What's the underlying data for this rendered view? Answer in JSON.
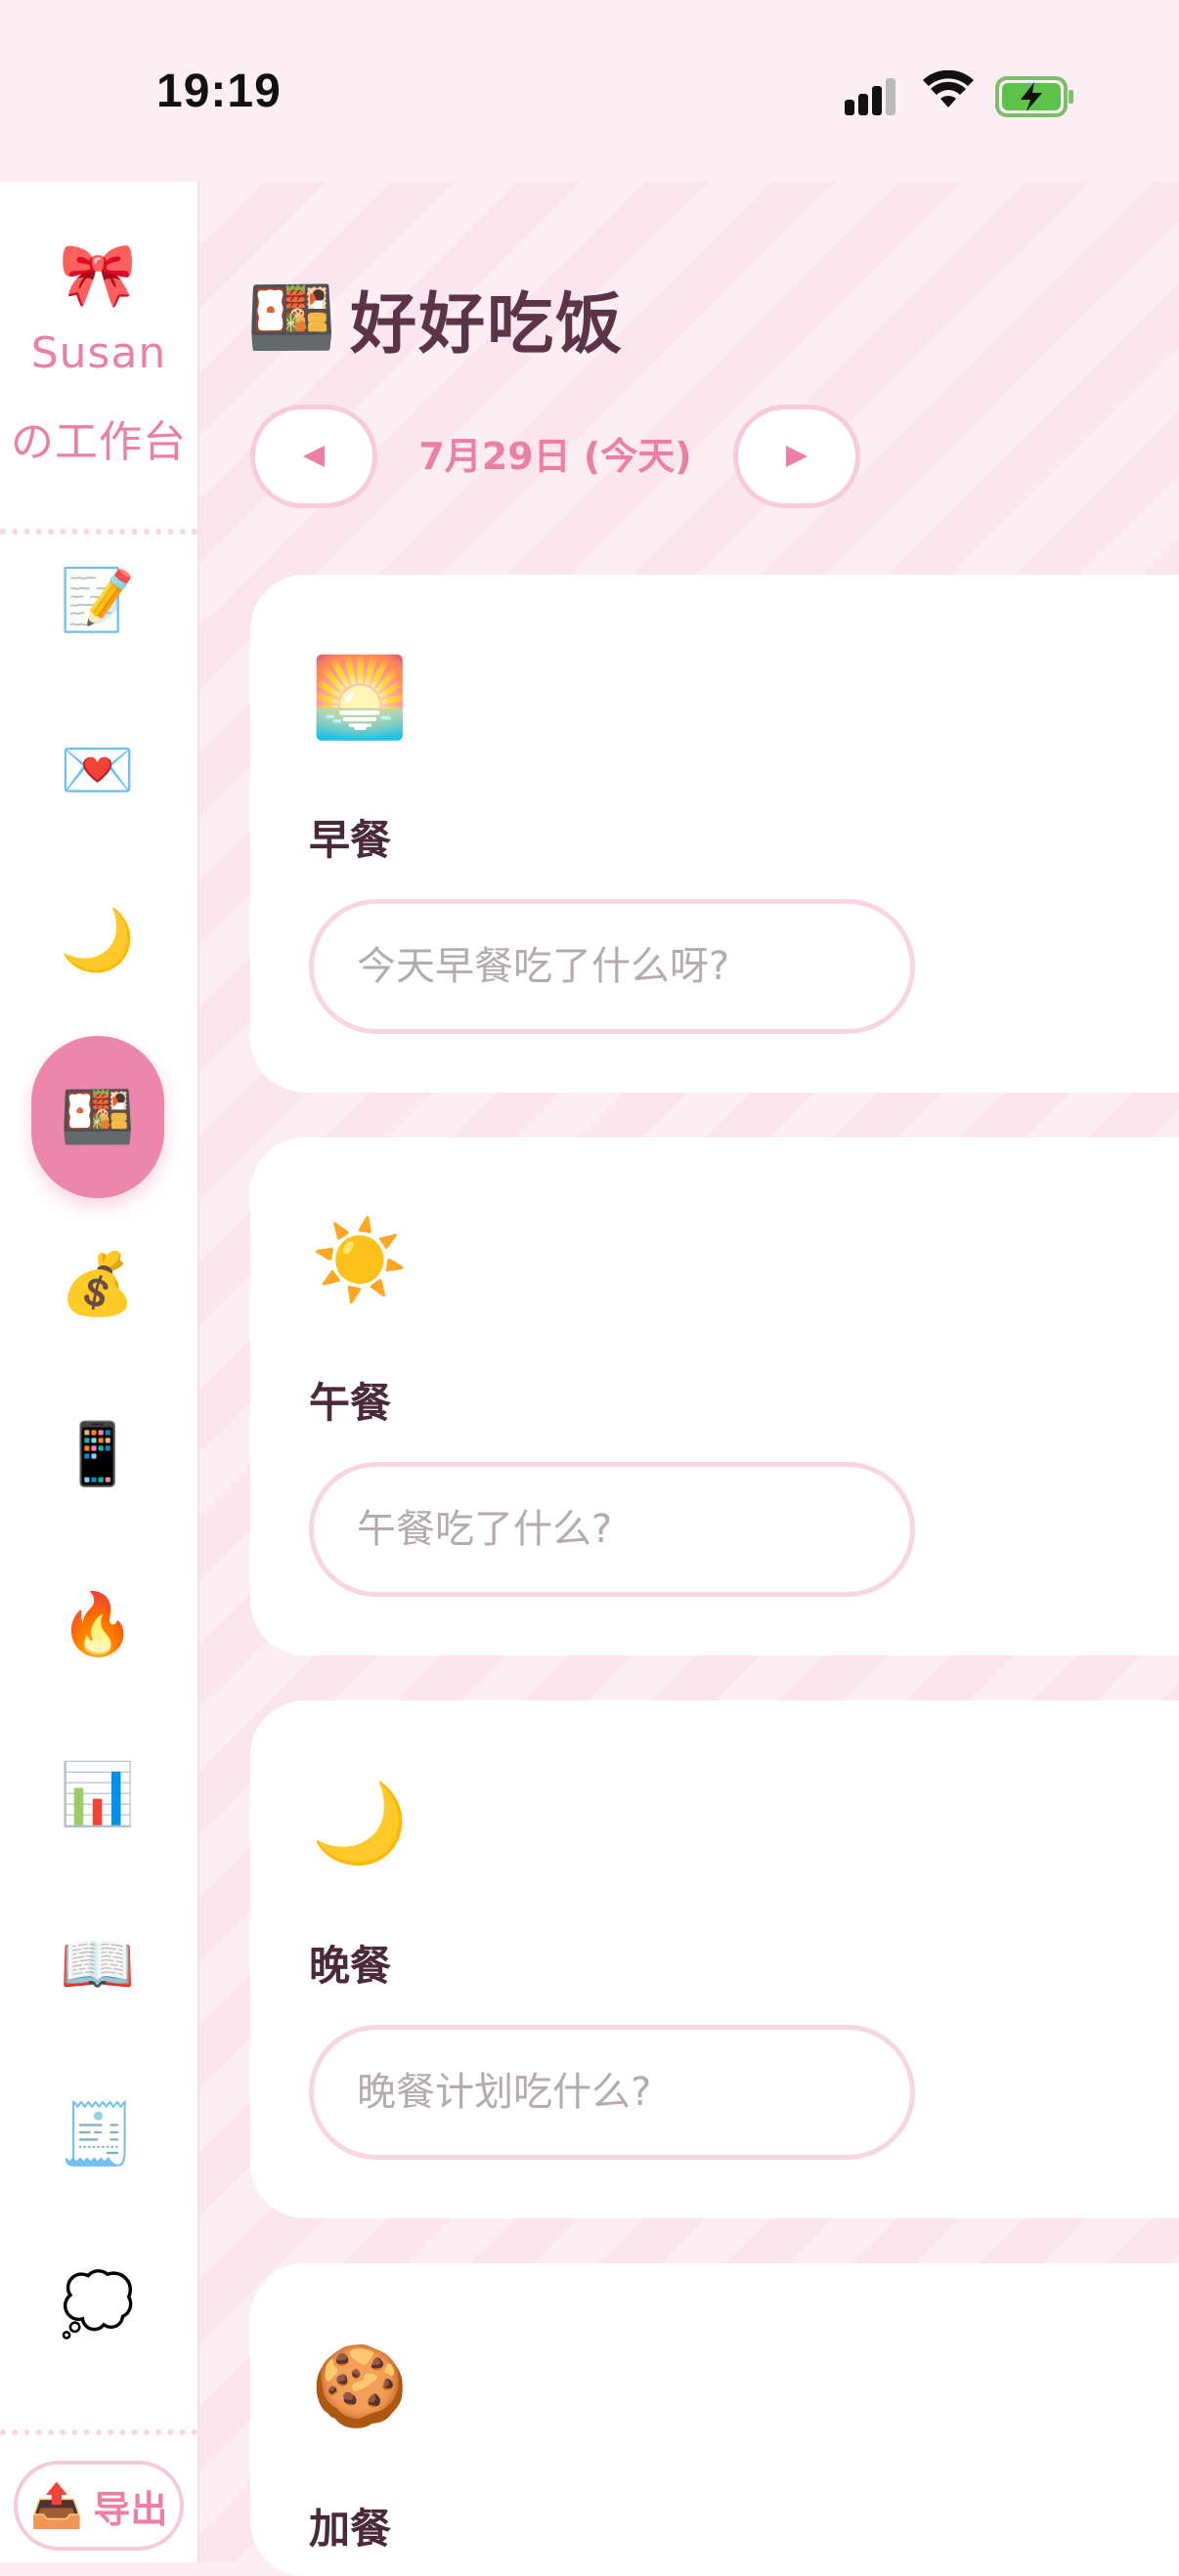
{
  "status_bar": {
    "time": "19:19"
  },
  "sidebar": {
    "brand_icon": "🎀",
    "brand_line1": "Susan",
    "brand_line2": "の工作台",
    "items": [
      {
        "name": "memo",
        "icon": "📝"
      },
      {
        "name": "love-letter",
        "icon": "💌"
      },
      {
        "name": "moon",
        "icon": "🌙"
      },
      {
        "name": "bento",
        "icon": "🍱",
        "active": true
      },
      {
        "name": "money-bag",
        "icon": "💰"
      },
      {
        "name": "phone",
        "icon": "📱"
      },
      {
        "name": "fire",
        "icon": "🔥"
      },
      {
        "name": "chart",
        "icon": "📊"
      },
      {
        "name": "book",
        "icon": "📖"
      },
      {
        "name": "receipt",
        "icon": "🧾"
      },
      {
        "name": "thought",
        "icon": "💭"
      }
    ],
    "export": {
      "icon": "📤",
      "label": "导出"
    }
  },
  "header": {
    "icon": "🍱",
    "title": "好好吃饭"
  },
  "date_nav": {
    "label": "7月29日 (今天)"
  },
  "meals": [
    {
      "icon": "🌅",
      "title": "早餐",
      "placeholder": "今天早餐吃了什么呀?"
    },
    {
      "icon": "☀️",
      "title": "午餐",
      "placeholder": "午餐吃了什么?"
    },
    {
      "icon": "🌙",
      "title": "晚餐",
      "placeholder": "晚餐计划吃什么?"
    },
    {
      "icon": "🍪",
      "title": "加餐",
      "placeholder": ""
    }
  ],
  "colors": {
    "accent": "#ec7fa5",
    "background": "#fdeef4",
    "title": "#5c3447"
  }
}
